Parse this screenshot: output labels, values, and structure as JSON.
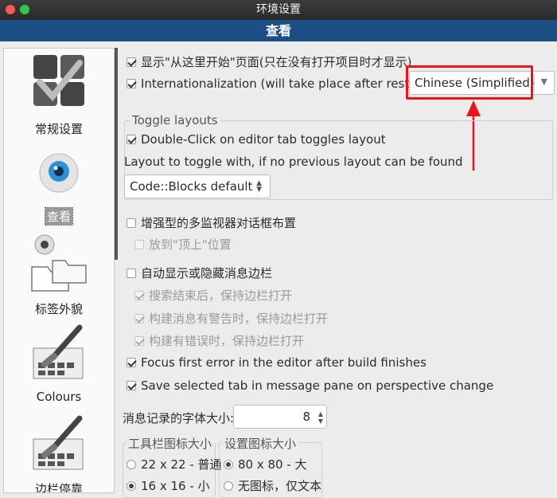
{
  "window": {
    "title": "环境设置"
  },
  "header": {
    "title": "查看"
  },
  "sidebar": {
    "items": [
      {
        "label": "常规设置",
        "icon": "settings-check-icon"
      },
      {
        "label": "查看",
        "icon": "eye-icon",
        "selected": true
      },
      {
        "label": "标签外貌",
        "icon": "folders-icon"
      },
      {
        "label": "Colours",
        "icon": "paintbrush-icon"
      },
      {
        "label": "边栏停靠",
        "icon": "paintbrush-icon"
      }
    ]
  },
  "options": {
    "show_start_here": "显示\"从这里开始\"页面(只在没有打开项目时才显示)",
    "internationalization": "Internationalization (will take place after restart)",
    "language_value": "Chinese (Simplified)",
    "toggle_group_title": "Toggle layouts",
    "double_click_toggle": "Double-Click on editor tab toggles layout",
    "layout_to_toggle_label": "Layout to toggle with, if no previous layout can be found",
    "layout_value": "Code::Blocks default",
    "enhanced_multimonitor": "增强型的多监视器对话框布置",
    "put_on_top": "放到\"顶上\"位置",
    "auto_show_hide": "自动显示或隐藏消息边栏",
    "keep_open_search": "搜索结束后，保持边栏打开",
    "keep_open_warnings": "构建消息有警告时，保持边栏打开",
    "keep_open_errors": "构建有错误时，保持边栏打开",
    "focus_first_error": "Focus first error in the editor after build finishes",
    "save_selected_tab": "Save selected tab in message pane on perspective change",
    "font_size_label": "消息记录的字体大小:",
    "font_size_value": "8",
    "toolbar_icon_group": "工具栏图标大小",
    "toolbar_22": "22 x 22 - 普通",
    "toolbar_16": "16 x 16 - 小",
    "settings_icon_group": "设置图标大小",
    "settings_80": "80 x 80 - 大",
    "settings_none": "无图标，仅文本"
  },
  "colors": {
    "accent": "#1d4f86",
    "highlight": "#e8141b"
  }
}
